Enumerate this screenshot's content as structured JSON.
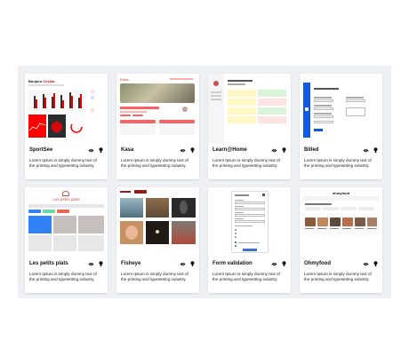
{
  "projects": [
    {
      "title": "SportSee",
      "description": "Lorem Ipsum is simply dummy text of the printing and typesetting industry.",
      "thumb_heading": "Bonjour",
      "thumb_name": "Cecilia"
    },
    {
      "title": "Kasa",
      "description": "Lorem Ipsum is simply dummy text of the printing and typesetting industry.",
      "thumb_heading": "Kasa"
    },
    {
      "title": "Learn@Home",
      "description": "Lorem Ipsum is simply dummy text of the printing and typesetting industry."
    },
    {
      "title": "Billed",
      "description": "Lorem Ipsum is simply dummy text of the printing and typesetting industry."
    },
    {
      "title": "Les petits plats",
      "description": "Lorem Ipsum is simply dummy text of the printing and typesetting industry.",
      "thumb_heading": "Les petits plats"
    },
    {
      "title": "Fisheye",
      "description": "Lorem Ipsum is simply dummy text of the printing and typesetting industry."
    },
    {
      "title": "Form validation",
      "description": "Lorem Ipsum is simply dummy text of the printing and typesetting industry."
    },
    {
      "title": "Ohmyfood",
      "description": "Lorem Ipsum is simply dummy text of the printing and typesetting industry.",
      "thumb_heading": "ohmyfood"
    }
  ],
  "icons": {
    "view": "eye-icon",
    "source": "github-icon"
  }
}
